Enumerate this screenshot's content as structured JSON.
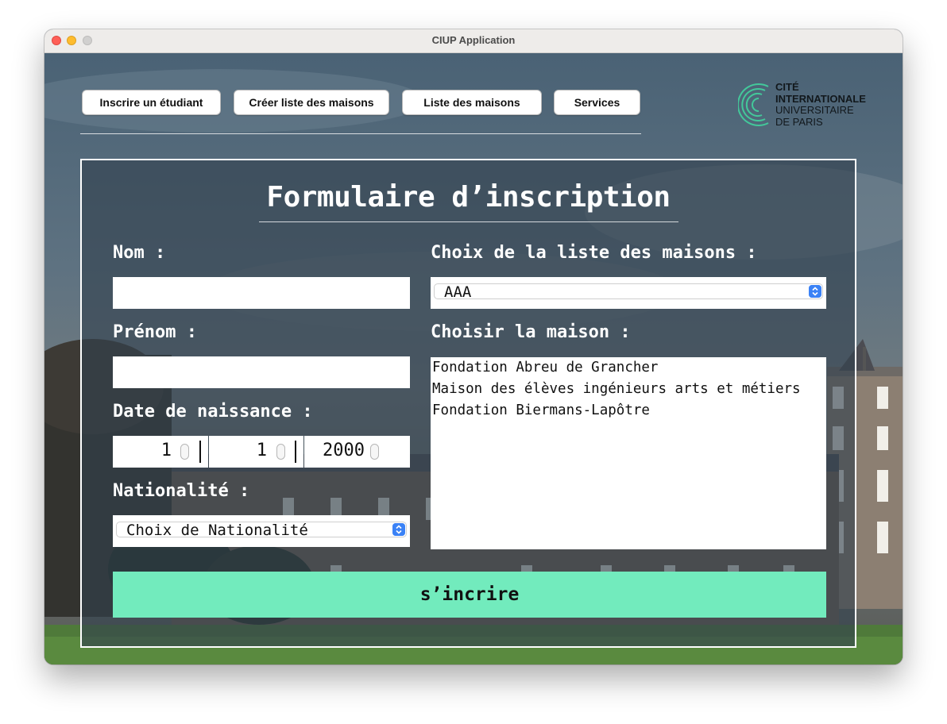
{
  "window": {
    "title": "CIUP Application"
  },
  "nav": {
    "buttons": [
      {
        "label": "Inscrire un étudiant"
      },
      {
        "label": "Créer liste des maisons"
      },
      {
        "label": "Liste des maisons"
      },
      {
        "label": "Services"
      }
    ]
  },
  "logo": {
    "line1": "CITÉ",
    "line2": "INTERNATIONALE",
    "line3": "UNIVERSITAIRE",
    "line4": "DE PARIS",
    "color": "#43c89a"
  },
  "form": {
    "title": "Formulaire d’inscription",
    "nom_label": "Nom :",
    "nom_value": "",
    "prenom_label": "Prénom :",
    "prenom_value": "",
    "birth_label": "Date de naissance :",
    "birth": {
      "day": "1",
      "month": "1",
      "year": "2000"
    },
    "nationality_label": "Nationalité :",
    "nationality_selected": "Choix de Nationalité",
    "house_list_label": "Choix de la liste des maisons :",
    "house_list_selected": "AAA",
    "house_label": "Choisir la maison :",
    "houses": [
      "Fondation Abreu de Grancher",
      "Maison des élèves ingénieurs arts et métiers",
      "Fondation Biermans-Lapôtre"
    ],
    "submit_label": "s’incrire"
  },
  "colors": {
    "accent": "#72ebbd",
    "select_arrow": "#3b82f6",
    "panel_border": "#ffffff"
  }
}
